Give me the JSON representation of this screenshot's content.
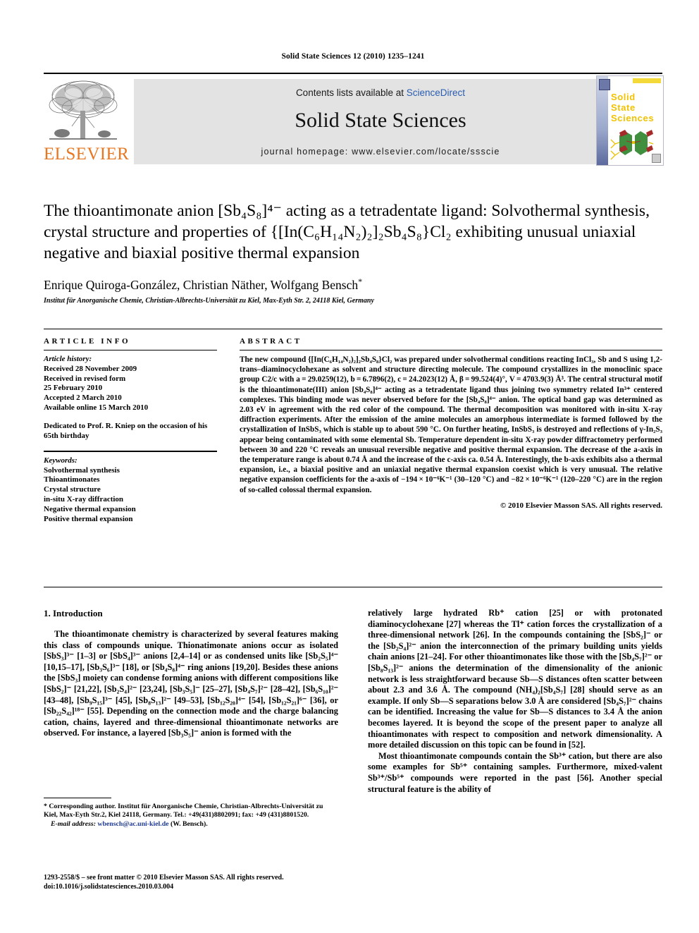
{
  "running_head": "Solid State Sciences 12 (2010) 1235–1241",
  "masthead": {
    "contents_prefix": "Contents lists available at ",
    "sciencedirect": "ScienceDirect",
    "journal_name": "Solid State Sciences",
    "homepage": "journal homepage: www.elsevier.com/locate/ssscie",
    "publisher_wordmark": "ELSEVIER",
    "publisher_color": "#E87722",
    "link_color": "#2a5db0",
    "banner_bg": "#e3e3e3",
    "cover": {
      "line1": "Solid",
      "line2": "State",
      "line3": "Sciences",
      "text_color": "#f2c200"
    }
  },
  "title": {
    "line1": "The thioantimonate anion [Sb₄S₈]⁴⁻ acting as a tetradentate ligand: Solvothermal",
    "line2": "synthesis, crystal structure and properties of {[In(C₆H₁₄N₂)₂]₂Sb₄S₈}Cl₂ exhibiting",
    "line3": "unusual uniaxial negative and biaxial positive thermal expansion",
    "authors": "Enrique Quiroga-González, Christian Näther, Wolfgang Bensch",
    "corresponding_marker": "*",
    "affiliation": "Institut für Anorganische Chemie, Christian-Albrechts-Universität zu Kiel, Max-Eyth Str. 2, 24118 Kiel, Germany"
  },
  "article_info": {
    "heading": "ARTICLE INFO",
    "history_label": "Article history:",
    "history": [
      "Received 28 November 2009",
      "Received in revised form",
      "25 February 2010",
      "Accepted 2 March 2010",
      "Available online 15 March 2010"
    ],
    "dedication": "Dedicated to Prof. R. Kniep on the occasion of his 65th birthday",
    "keywords_label": "Keywords:",
    "keywords": [
      "Solvothermal synthesis",
      "Thioantimonates",
      "Crystal structure",
      "in-situ X-ray diffraction",
      "Negative thermal expansion",
      "Positive thermal expansion"
    ]
  },
  "abstract": {
    "heading": "ABSTRACT",
    "text": "The new compound {[In(C₆H₁₄N₂)₂]₂Sb₄S₈}Cl₂ was prepared under solvothermal conditions reacting InCl₃, Sb and S using 1,2-trans–diaminocyclohexane as solvent and structure directing molecule. The compound crystallizes in the monoclinic space group C2/c with a = 29.0259(12), b = 6.7896(2), c = 24.2023(12) Å, β = 99.524(4)°, V = 4703.9(3) Å³. The central structural motif is the thioantimonate(III) anion [Sb₄S₈]⁴⁻ acting as a tetradentate ligand thus joining two symmetry related In³⁺ centered complexes. This binding mode was never observed before for the [Sb₄S₈]⁴⁻ anion. The optical band gap was determined as 2.03 eV in agreement with the red color of the compound. The thermal decomposition was monitored with in-situ X-ray diffraction experiments. After the emission of the amine molecules an amorphous intermediate is formed followed by the crystallization of InSbS₃ which is stable up to about 590 °C. On further heating, InSbS₃ is destroyed and reflections of γ-In₂S₃ appear being contaminated with some elemental Sb. Temperature dependent in-situ X-ray powder diffractometry performed between 30 and 220 °C reveals an unusual reversible negative and positive thermal expansion. The decrease of the a-axis in the temperature range is about 0.74 Å and the increase of the c-axis ca. 0.54 Å. Interestingly, the b-axis exhibits also a thermal expansion, i.e., a biaxial positive and an uniaxial negative thermal expansion coexist which is very unusual. The relative negative expansion coefficients for the a-axis of −194 × 10⁻⁶K⁻¹ (30–120 °C) and −82 × 10⁻⁶K⁻¹ (120–220 °C) are in the region of so-called colossal thermal expansion.",
    "copyright": "© 2010 Elsevier Masson SAS. All rights reserved."
  },
  "body": {
    "section_heading": "1. Introduction",
    "left_paragraph": "The thioantimonate chemistry is characterized by several features making this class of compounds unique. Thionatimonate anions occur as isolated [SbS₃]³⁻ [1–3] or [SbS₄]³⁻ anions [2,4–14] or as condensed units like [Sb₂S₅]⁴⁻ [10,15–17], [Sb₃S₆]³⁻ [18], or [Sb₄S₈]⁴⁻ ring anions [19,20]. Besides these anions the [SbS₃] moiety can condense forming anions with different compositions like [SbS₂]⁻ [21,22], [Sb₂S₄]²⁻ [23,24], [Sb₃S₅]⁻ [25–27], [Sb₄S₇]²⁻ [28–42], [Sb₆S₁₀]²⁻ [43–48], [Sb₉S₁₅]³⁻ [45], [Sb₈S₁₃]²⁻ [49–53], [Sb₁₂S₂₀]⁴⁻ [54], [Sb₁₂S₂₁]⁶⁻ [36], or [Sb₂₂S₄₂]¹⁸⁻ [55]. Depending on the connection mode and the charge balancing cation, chains, layered and three-dimensional thioantimonate networks are observed. For instance, a layered [Sb₃S₅]⁻ anion is formed with the",
    "right_paragraph_1": "relatively large hydrated Rb⁺ cation [25] or with protonated diaminocyclohexane [27] whereas the Tl⁺ cation forces the crystallization of a three-dimensional network [26]. In the compounds containing the [SbS₂]⁻ or the [Sb₂S₄]²⁻ anion the interconnection of the primary building units yields chain anions [21–24]. For other thioantimonates like those with the [Sb₄S₇]²⁻ or [Sb₈S₁₃]²⁻ anions the determination of the dimensionality of the anionic network is less straightforward because Sb—S distances often scatter between about 2.3 and 3.6 Å. The compound (NH₄)₂[Sb₄S₇] [28] should serve as an example. If only Sb—S separations below 3.0 Å are considered [Sb₄S₇]²⁻ chains can be identified. Increasing the value for Sb—S distances to 3.4 Å the anion becomes layered. It is beyond the scope of the present paper to analyze all thioantimonates with respect to composition and network dimensionality. A more detailed discussion on this topic can be found in [52].",
    "right_paragraph_2": "Most thioantimonate compounds contain the Sb³⁺ cation, but there are also some examples for Sb⁵⁺ containing samples. Furthermore, mixed-valent Sb³⁺/Sb⁵⁺ compounds were reported in the past [56]. Another special structural feature is the ability of"
  },
  "footnotes": {
    "corresponding": "* Corresponding author. Institut für Anorganische Chemie, Christian-Albrechts-Universität zu Kiel, Max-Eyth Str.2, Kiel 24118, Germany. Tel.: +49(431)8802091; fax: +49 (431)8801520.",
    "email_label": "E-mail address:",
    "email": "wbensch@ac.uni-kiel.de",
    "email_suffix": "(W. Bensch).",
    "imprint_line1": "1293-2558/$ – see front matter © 2010 Elsevier Masson SAS. All rights reserved.",
    "imprint_line2": "doi:10.1016/j.solidstatesciences.2010.03.004"
  }
}
